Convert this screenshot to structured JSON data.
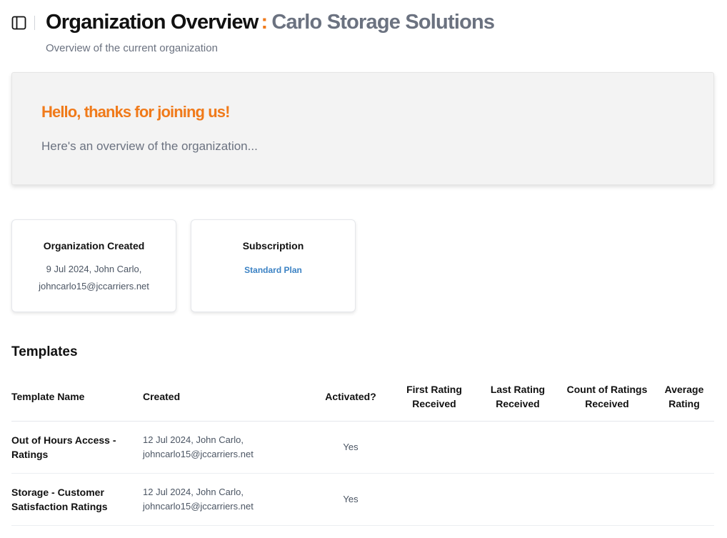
{
  "header": {
    "title": "Organization Overview",
    "separator": ":",
    "org_name": "Carlo Storage Solutions",
    "subtitle": "Overview of the current organization"
  },
  "welcome": {
    "heading": "Hello, thanks for joining us!",
    "text": "Here's an overview of the organization..."
  },
  "created_card": {
    "label": "Organization Created",
    "line1": "9 Jul 2024, John Carlo,",
    "line2": "johncarlo15@jccarriers.net"
  },
  "subscription_card": {
    "label": "Subscription",
    "plan": "Standard Plan"
  },
  "templates": {
    "title": "Templates",
    "columns": {
      "name": "Template Name",
      "created": "Created",
      "activated": "Activated?",
      "first": "First Rating Received",
      "last": "Last Rating Received",
      "count": "Count of Ratings Received",
      "average": "Average Rating"
    },
    "rows": [
      {
        "name": "Out of Hours Access - Ratings",
        "created_line1": "12 Jul 2024, John Carlo,",
        "created_line2": "johncarlo15@jccarriers.net",
        "activated": "Yes",
        "first": "",
        "last": "",
        "count": "",
        "average": ""
      },
      {
        "name": "Storage - Customer Satisfaction Ratings",
        "created_line1": "12 Jul 2024, John Carlo,",
        "created_line2": "johncarlo15@jccarriers.net",
        "activated": "Yes",
        "first": "",
        "last": "",
        "count": "",
        "average": ""
      }
    ]
  },
  "colors": {
    "accent": "#f07a1a",
    "link": "#3b82c4",
    "muted": "#6b7280"
  },
  "icons": {
    "sidebar_toggle": "sidebar-panel-icon"
  }
}
